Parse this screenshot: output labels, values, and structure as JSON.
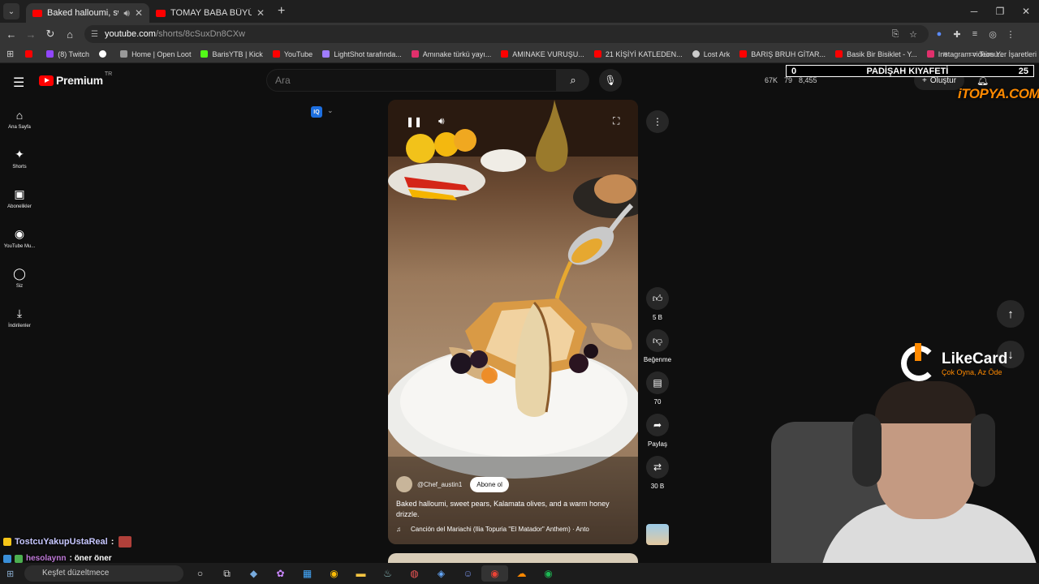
{
  "browser": {
    "tabs": [
      {
        "title": "Baked halloumi, sweet pea",
        "active": true
      },
      {
        "title": "TOMAY BABA BÜYÜK SIRRI ÇÖZ",
        "active": false
      }
    ],
    "url_host": "youtube.com",
    "url_path": "/shorts/8cSuxDn8CXw",
    "bookmarks": [
      "(8) Twitch",
      "Home | Open Loot",
      "BarisYTB | Kick",
      "YouTube",
      "LightShot tarafında...",
      "Amınake türkü yayı...",
      "AMINAKE VURUŞU...",
      "21 KİŞİYİ KATLEDEN...",
      "Lost Ark",
      "BARIŞ BRUH GİTAR...",
      "Basik Bir Bisiklet - Y...",
      "Instagram videosu:..."
    ],
    "all_bookmarks": "Tüm Yer İşaretleri"
  },
  "header": {
    "logo_text": "Premium",
    "logo_region": "TR",
    "search_placeholder": "Ara",
    "stats": [
      "67K",
      "79",
      "8,455"
    ],
    "create_label": "Oluştur"
  },
  "overlay": {
    "scoreboard_left": "0",
    "scoreboard_title": "PADİŞAH KIYAFETİ",
    "scoreboard_right": "25",
    "sponsor": "iTOPYA.COM",
    "likecard_name": "LikeCard",
    "likecard_tagline": "Çok Oyna, Az Öde"
  },
  "sidebar": [
    {
      "label": "Ana Sayfa",
      "icon": "home-icon",
      "glyph": "⌂"
    },
    {
      "label": "Shorts",
      "icon": "shorts-icon",
      "glyph": "✦"
    },
    {
      "label": "Abonelikler",
      "icon": "subscriptions-icon",
      "glyph": "▣"
    },
    {
      "label": "YouTube Mu...",
      "icon": "music-icon",
      "glyph": "◉"
    },
    {
      "label": "Siz",
      "icon": "profile-icon",
      "glyph": "◯"
    },
    {
      "label": "İndirilenler",
      "icon": "download-icon",
      "glyph": "⤓"
    }
  ],
  "short": {
    "channel": "@Chef_austin1",
    "subscribe_label": "Abone ol",
    "description": "Baked halloumi, sweet pears, Kalamata olives, and a warm honey drizzle.",
    "song": "Canción del Mariachi (Ilia Topuria \"El Matador\" Anthem) · Anto",
    "iq_label": "IQ"
  },
  "actions": {
    "likes": "5 B",
    "dislike_label": "Beğenme",
    "comments": "70",
    "share_label": "Paylaş",
    "remix": "30 B"
  },
  "chat": [
    {
      "user": "TostcuYakupUstaReal",
      "message": ":"
    },
    {
      "user": "hesolaynn",
      "message": ": öner öner"
    }
  ],
  "taskbar": {
    "search_text": "Keşfet düzeltmece"
  },
  "colors": {
    "youtube_red": "#ff0000",
    "background": "#0f0f0f",
    "accent_orange": "#ff8a00"
  }
}
